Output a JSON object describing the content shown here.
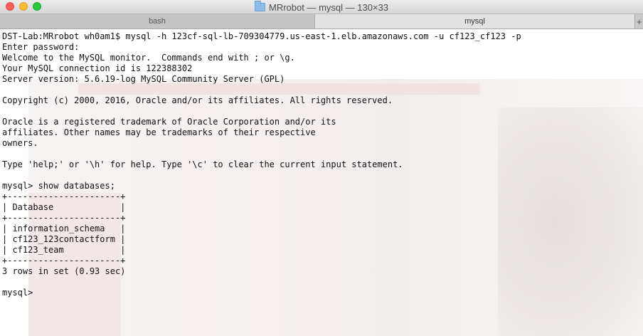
{
  "window": {
    "title": "MRrobot — mysql — 130×33"
  },
  "tabs": [
    {
      "label": "bash",
      "active": false
    },
    {
      "label": "mysql",
      "active": true
    }
  ],
  "new_tab_label": "+",
  "terminal": {
    "lines": [
      "DST-Lab:MRrobot wh0am1$ mysql -h 123cf-sql-lb-709304779.us-east-1.elb.amazonaws.com -u cf123_cf123 -p",
      "Enter password:",
      "Welcome to the MySQL monitor.  Commands end with ; or \\g.",
      "Your MySQL connection id is 122388302",
      "Server version: 5.6.19-log MySQL Community Server (GPL)",
      "",
      "Copyright (c) 2000, 2016, Oracle and/or its affiliates. All rights reserved.",
      "",
      "Oracle is a registered trademark of Oracle Corporation and/or its",
      "affiliates. Other names may be trademarks of their respective",
      "owners.",
      "",
      "Type 'help;' or '\\h' for help. Type '\\c' to clear the current input statement.",
      "",
      "mysql> show databases;",
      "+----------------------+",
      "| Database             |",
      "+----------------------+",
      "| information_schema   |",
      "| cf123_123contactform |",
      "| cf123_team           |",
      "+----------------------+",
      "3 rows in set (0.93 sec)",
      "",
      "mysql> "
    ]
  },
  "colors": {
    "close": "#fc5f57",
    "minimize": "#fdbc2e",
    "maximize": "#28c840",
    "text": "#111111"
  }
}
